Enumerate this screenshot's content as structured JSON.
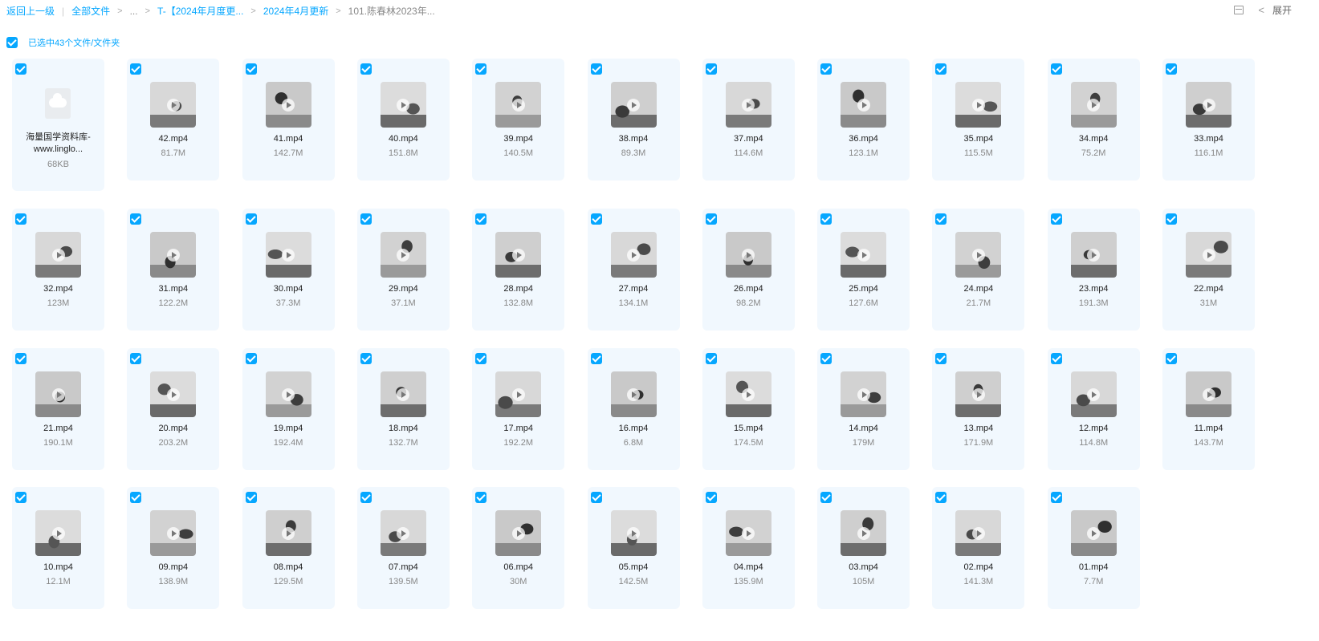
{
  "breadcrumb": {
    "back": "返回上一级",
    "all_files": "全部文件",
    "ellipsis": "...",
    "folder1": "T-【2024年月度更...",
    "folder2": "2024年4月更新",
    "current": "101.陈春林2023年..."
  },
  "toolbar": {
    "expand": "展开"
  },
  "selection": {
    "label": "已选中43个文件/文件夹"
  },
  "files": [
    {
      "name": "海量国学资料库-www.linglo...",
      "size": "68KB",
      "type": "doc"
    },
    {
      "name": "42.mp4",
      "size": "81.7M"
    },
    {
      "name": "41.mp4",
      "size": "142.7M"
    },
    {
      "name": "40.mp4",
      "size": "151.8M"
    },
    {
      "name": "39.mp4",
      "size": "140.5M"
    },
    {
      "name": "38.mp4",
      "size": "89.3M"
    },
    {
      "name": "37.mp4",
      "size": "114.6M"
    },
    {
      "name": "36.mp4",
      "size": "123.1M"
    },
    {
      "name": "35.mp4",
      "size": "115.5M"
    },
    {
      "name": "34.mp4",
      "size": "75.2M"
    },
    {
      "name": "33.mp4",
      "size": "116.1M"
    },
    {
      "name": "32.mp4",
      "size": "123M"
    },
    {
      "name": "31.mp4",
      "size": "122.2M"
    },
    {
      "name": "30.mp4",
      "size": "37.3M"
    },
    {
      "name": "29.mp4",
      "size": "37.1M"
    },
    {
      "name": "28.mp4",
      "size": "132.8M"
    },
    {
      "name": "27.mp4",
      "size": "134.1M"
    },
    {
      "name": "26.mp4",
      "size": "98.2M"
    },
    {
      "name": "25.mp4",
      "size": "127.6M"
    },
    {
      "name": "24.mp4",
      "size": "21.7M"
    },
    {
      "name": "23.mp4",
      "size": "191.3M"
    },
    {
      "name": "22.mp4",
      "size": "31M"
    },
    {
      "name": "21.mp4",
      "size": "190.1M"
    },
    {
      "name": "20.mp4",
      "size": "203.2M"
    },
    {
      "name": "19.mp4",
      "size": "192.4M"
    },
    {
      "name": "18.mp4",
      "size": "132.7M"
    },
    {
      "name": "17.mp4",
      "size": "192.2M"
    },
    {
      "name": "16.mp4",
      "size": "6.8M"
    },
    {
      "name": "15.mp4",
      "size": "174.5M"
    },
    {
      "name": "14.mp4",
      "size": "179M"
    },
    {
      "name": "13.mp4",
      "size": "171.9M"
    },
    {
      "name": "12.mp4",
      "size": "114.8M"
    },
    {
      "name": "11.mp4",
      "size": "143.7M"
    },
    {
      "name": "10.mp4",
      "size": "12.1M"
    },
    {
      "name": "09.mp4",
      "size": "138.9M"
    },
    {
      "name": "08.mp4",
      "size": "129.5M"
    },
    {
      "name": "07.mp4",
      "size": "139.5M"
    },
    {
      "name": "06.mp4",
      "size": "30M"
    },
    {
      "name": "05.mp4",
      "size": "142.5M"
    },
    {
      "name": "04.mp4",
      "size": "135.9M"
    },
    {
      "name": "03.mp4",
      "size": "105M"
    },
    {
      "name": "02.mp4",
      "size": "141.3M"
    },
    {
      "name": "01.mp4",
      "size": "7.7M"
    }
  ],
  "colors": {
    "accent": "#06a7ff",
    "card_bg": "#f1f8fe"
  }
}
